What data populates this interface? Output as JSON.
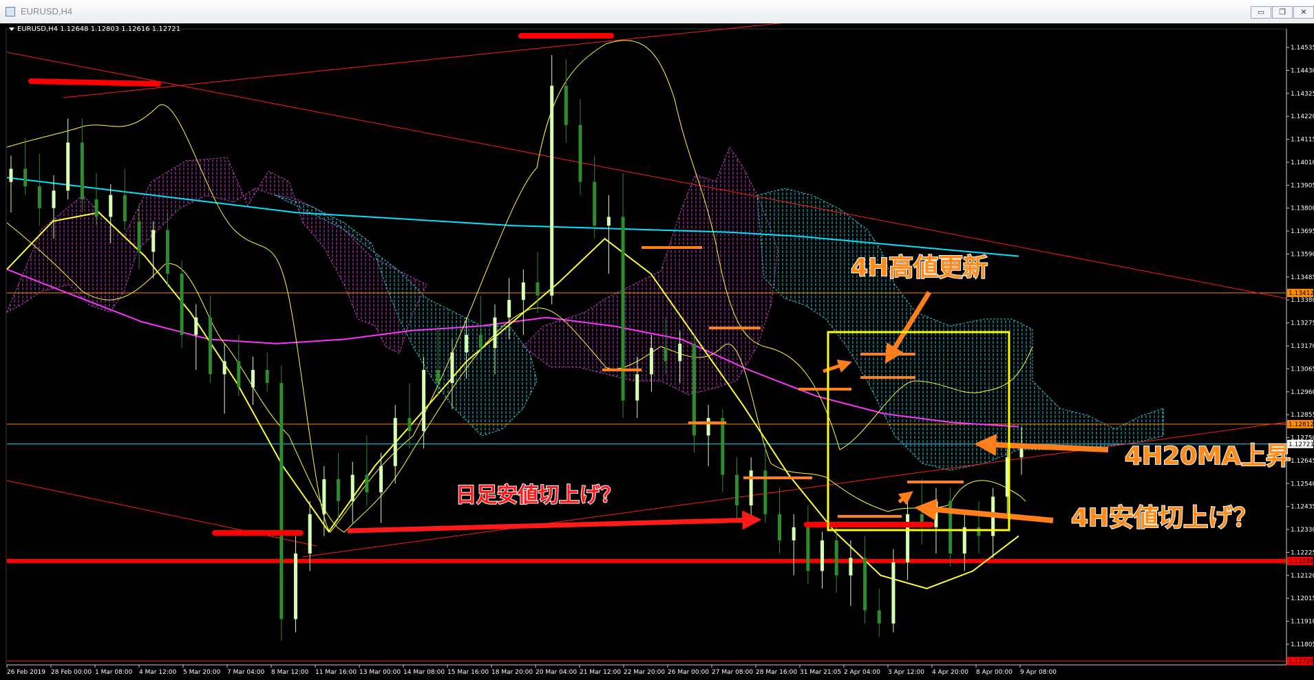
{
  "window": {
    "title": "EURUSD,H4",
    "minimize_icon": "minimize-icon",
    "restore_icon": "restore-icon",
    "close_icon": "close-icon"
  },
  "chart_data": {
    "type": "candlestick",
    "symbol_info": "EURUSD,H4  1.12648 1.12803 1.12616 1.12721",
    "y_axis": {
      "ticks": [
        "1.14535",
        "1.14430",
        "1.14325",
        "1.14220",
        "1.14115",
        "1.14010",
        "1.13905",
        "1.13800",
        "1.13695",
        "1.13590",
        "1.13485",
        "1.13380",
        "1.13275",
        "1.13170",
        "1.13065",
        "1.12960",
        "1.12855",
        "1.12750",
        "1.12645",
        "1.12540",
        "1.12435",
        "1.12330",
        "1.12225",
        "1.12120",
        "1.12015",
        "1.11910",
        "1.11805"
      ],
      "ylim": [
        1.1172,
        1.1462
      ],
      "price_labels": [
        {
          "text": "1.13412",
          "price": 1.13412,
          "color": "#ff8c00"
        },
        {
          "text": "1.12812",
          "price": 1.12812,
          "color": "#ff8c00"
        },
        {
          "text": "1.12721",
          "price": 1.12721,
          "color": "#ffffff"
        },
        {
          "text": "1.12186",
          "price": 1.12186,
          "color": "#ff0000"
        },
        {
          "text": "1.11728",
          "price": 1.11728,
          "color": "#ff0000"
        }
      ]
    },
    "x_axis": {
      "labels": [
        "26 Feb 2019",
        "28 Feb 00:00",
        "1 Mar 08:00",
        "4 Mar 12:00",
        "5 Mar 20:00",
        "7 Mar 04:00",
        "8 Mar 12:00",
        "11 Mar 16:00",
        "13 Mar 00:00",
        "14 Mar 08:00",
        "15 Mar 16:00",
        "18 Mar 20:00",
        "20 Mar 04:00",
        "21 Mar 12:00",
        "22 Mar 20:00",
        "26 Mar 00:00",
        "27 Mar 08:00",
        "28 Mar 16:00",
        "31 Mar 21:05",
        "2 Apr 04:00",
        "3 Apr 12:00",
        "4 Apr 20:00",
        "8 Apr 00:00",
        "9 Apr 08:00"
      ]
    },
    "candles_ohlc": [
      [
        1.1392,
        1.1404,
        1.1378,
        1.1398
      ],
      [
        1.1398,
        1.1412,
        1.1386,
        1.139
      ],
      [
        1.139,
        1.1405,
        1.1372,
        1.138
      ],
      [
        1.138,
        1.1395,
        1.1366,
        1.1388
      ],
      [
        1.1388,
        1.1421,
        1.1384,
        1.141
      ],
      [
        1.141,
        1.1421,
        1.1378,
        1.1384
      ],
      [
        1.1384,
        1.1396,
        1.1372,
        1.1376
      ],
      [
        1.1376,
        1.1391,
        1.1364,
        1.1386
      ],
      [
        1.1386,
        1.1398,
        1.137,
        1.1374
      ],
      [
        1.1374,
        1.1382,
        1.1352,
        1.136
      ],
      [
        1.136,
        1.1374,
        1.1348,
        1.137
      ],
      [
        1.137,
        1.1378,
        1.1344,
        1.135
      ],
      [
        1.135,
        1.1356,
        1.1316,
        1.1322
      ],
      [
        1.1322,
        1.1336,
        1.1306,
        1.133
      ],
      [
        1.133,
        1.134,
        1.13,
        1.1304
      ],
      [
        1.1304,
        1.1318,
        1.1286,
        1.131
      ],
      [
        1.131,
        1.1322,
        1.1294,
        1.1298
      ],
      [
        1.1298,
        1.1312,
        1.129,
        1.1306
      ],
      [
        1.1306,
        1.1314,
        1.1296,
        1.13
      ],
      [
        1.13,
        1.1308,
        1.1182,
        1.1192
      ],
      [
        1.1192,
        1.123,
        1.1186,
        1.1222
      ],
      [
        1.1222,
        1.1246,
        1.1214,
        1.124
      ],
      [
        1.124,
        1.1262,
        1.123,
        1.1256
      ],
      [
        1.1256,
        1.1268,
        1.1238,
        1.1246
      ],
      [
        1.1246,
        1.1264,
        1.1236,
        1.1258
      ],
      [
        1.1258,
        1.1276,
        1.1244,
        1.125
      ],
      [
        1.125,
        1.1268,
        1.1236,
        1.1262
      ],
      [
        1.1262,
        1.129,
        1.1254,
        1.1284
      ],
      [
        1.1284,
        1.13,
        1.127,
        1.1278
      ],
      [
        1.1278,
        1.1312,
        1.127,
        1.1306
      ],
      [
        1.1306,
        1.1326,
        1.1294,
        1.13
      ],
      [
        1.13,
        1.132,
        1.1288,
        1.1314
      ],
      [
        1.1314,
        1.133,
        1.1302,
        1.1322
      ],
      [
        1.1322,
        1.134,
        1.131,
        1.1316
      ],
      [
        1.1316,
        1.1336,
        1.1304,
        1.133
      ],
      [
        1.133,
        1.1348,
        1.132,
        1.1338
      ],
      [
        1.1338,
        1.1352,
        1.1322,
        1.1346
      ],
      [
        1.1346,
        1.136,
        1.1332,
        1.134
      ],
      [
        1.134,
        1.145,
        1.1336,
        1.1436
      ],
      [
        1.1436,
        1.1448,
        1.141,
        1.1418
      ],
      [
        1.1418,
        1.143,
        1.1386,
        1.1392
      ],
      [
        1.1392,
        1.1404,
        1.1366,
        1.1372
      ],
      [
        1.1372,
        1.1386,
        1.135,
        1.1376
      ],
      [
        1.1376,
        1.1396,
        1.1284,
        1.1292
      ],
      [
        1.1292,
        1.1312,
        1.1284,
        1.1304
      ],
      [
        1.1304,
        1.1322,
        1.1296,
        1.1316
      ],
      [
        1.1316,
        1.133,
        1.1304,
        1.131
      ],
      [
        1.131,
        1.1324,
        1.13,
        1.1318
      ],
      [
        1.1318,
        1.1322,
        1.1268,
        1.1276
      ],
      [
        1.1276,
        1.129,
        1.1262,
        1.1284
      ],
      [
        1.1284,
        1.1288,
        1.125,
        1.1258
      ],
      [
        1.1258,
        1.1266,
        1.1236,
        1.1244
      ],
      [
        1.1244,
        1.1266,
        1.1236,
        1.126
      ],
      [
        1.126,
        1.1272,
        1.1236,
        1.124
      ],
      [
        1.124,
        1.1252,
        1.1222,
        1.1228
      ],
      [
        1.1228,
        1.124,
        1.1212,
        1.1234
      ],
      [
        1.1234,
        1.1244,
        1.1208,
        1.1214
      ],
      [
        1.1214,
        1.1232,
        1.1206,
        1.1228
      ],
      [
        1.1228,
        1.1236,
        1.1204,
        1.1212
      ],
      [
        1.1212,
        1.1228,
        1.1198,
        1.122
      ],
      [
        1.122,
        1.123,
        1.119,
        1.1196
      ],
      [
        1.1196,
        1.1206,
        1.1184,
        1.119
      ],
      [
        1.119,
        1.1224,
        1.1186,
        1.1218
      ],
      [
        1.1218,
        1.1248,
        1.121,
        1.124
      ],
      [
        1.124,
        1.1256,
        1.1226,
        1.1234
      ],
      [
        1.1234,
        1.1252,
        1.1222,
        1.1246
      ],
      [
        1.1246,
        1.1252,
        1.1216,
        1.1222
      ],
      [
        1.1222,
        1.124,
        1.1214,
        1.1234
      ],
      [
        1.1234,
        1.1246,
        1.1222,
        1.123
      ],
      [
        1.123,
        1.1252,
        1.122,
        1.1248
      ],
      [
        1.1248,
        1.127,
        1.124,
        1.1266
      ],
      [
        1.1266,
        1.128,
        1.1258,
        1.1272
      ]
    ],
    "moving_averages": [
      {
        "name": "",
        "color": "#00e5ff",
        "values": [
          1.1394,
          1.139,
          1.1386,
          1.1382,
          1.1378,
          1.1376,
          1.1374,
          1.1372,
          1.1371,
          1.137,
          1.1369,
          1.1367,
          1.1364,
          1.1361,
          1.1358
        ]
      },
      {
        "name": "",
        "color": "#ff33ff",
        "values": [
          1.1352,
          1.134,
          1.1328,
          1.132,
          1.1318,
          1.132,
          1.1324,
          1.1326,
          1.133,
          1.1326,
          1.132,
          1.1306,
          1.1294,
          1.1286,
          1.1282,
          1.128
        ]
      },
      {
        "name": "",
        "color": "#ffff33",
        "values": [
          1.1352,
          1.1374,
          1.1378,
          1.1358,
          1.1332,
          1.13,
          1.1262,
          1.1232,
          1.1262,
          1.1286,
          1.131,
          1.1328,
          1.1346,
          1.1366,
          1.135,
          1.132,
          1.129,
          1.1258,
          1.1232,
          1.1212,
          1.1206,
          1.1214,
          1.123
        ]
      }
    ],
    "horizontal_lines": [
      {
        "price": 1.13412,
        "color": "#ff8c00"
      },
      {
        "price": 1.12812,
        "color": "#ff8c00"
      },
      {
        "price": 1.12721,
        "color": "#00e5ff"
      },
      {
        "price": 1.12186,
        "color": "#ff0000"
      },
      {
        "price": 1.11728,
        "color": "#ff0000"
      }
    ],
    "annotations": [
      {
        "text": "4H高値更新",
        "color": "#ff8c1a"
      },
      {
        "text": "4H20MA上昇",
        "color": "#ff8c1a"
      },
      {
        "text": "4H安値切上げ？",
        "color": "#ff8c1a"
      },
      {
        "text": "日足安値切上げ？",
        "color": "#ff1a1a"
      }
    ],
    "grid": false,
    "background": "#000000",
    "bull_color": "#d7ffb0",
    "bear_color": "#2e8b2e"
  }
}
